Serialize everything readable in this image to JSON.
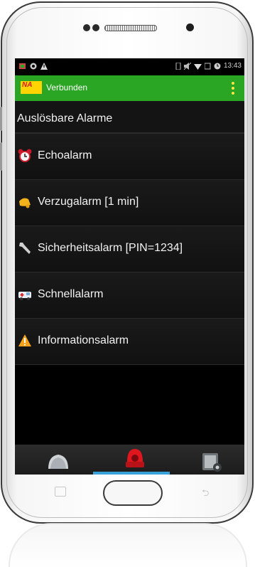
{
  "status_bar": {
    "time": "13:43",
    "left_icons": [
      "notification-icon",
      "app-icon",
      "warning-icon"
    ],
    "right_icons": [
      "vibrate-icon",
      "mute-icon",
      "wifi-icon",
      "signal-icon",
      "alarm-clock-icon"
    ]
  },
  "action_bar": {
    "logo_text": "NA",
    "title": "Verbunden",
    "menu_icon": "overflow-menu-icon",
    "color": "#2aa524"
  },
  "section": {
    "title": "Auslösbare Alarme"
  },
  "alarms": [
    {
      "icon": "alarm-clock-icon",
      "label": "Echoalarm"
    },
    {
      "icon": "bell-icon",
      "label": "Verzugalarm [1 min]"
    },
    {
      "icon": "wrench-icon",
      "label": "Sicherheitsalarm [PIN=1234]"
    },
    {
      "icon": "ambulance-icon",
      "label": "Schnellalarm"
    },
    {
      "icon": "warning-triangle-icon",
      "label": "Informationsalarm"
    }
  ],
  "tabs": [
    {
      "icon": "helmet-icon",
      "selected": false
    },
    {
      "icon": "alarm-beacon-icon",
      "selected": true
    },
    {
      "icon": "device-settings-icon",
      "selected": false
    }
  ],
  "colors": {
    "tab_indicator": "#3aa0d8",
    "logo_bg": "#ffd400"
  }
}
